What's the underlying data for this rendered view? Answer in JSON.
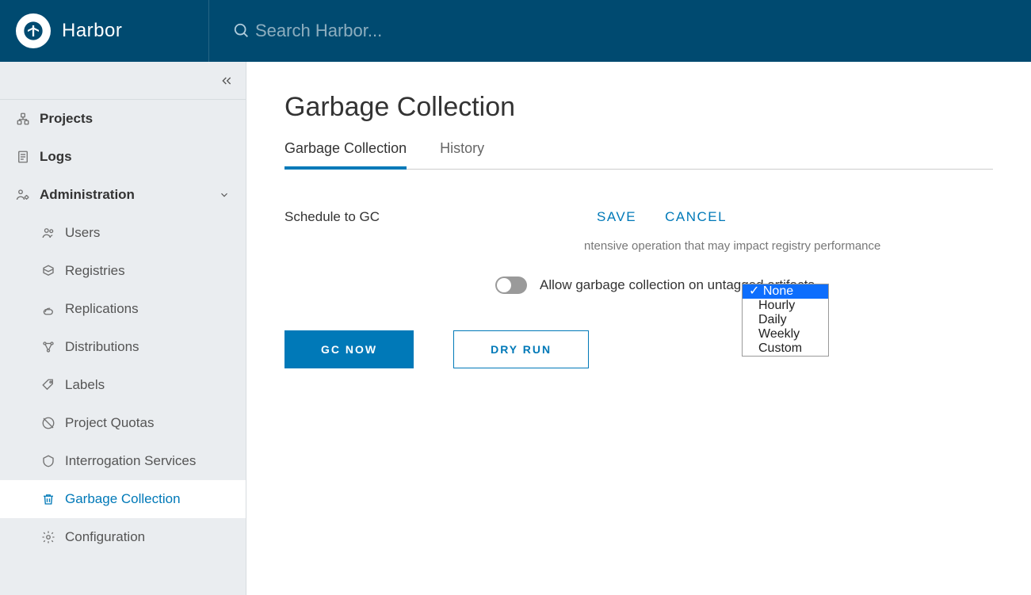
{
  "header": {
    "product": "Harbor",
    "search_placeholder": "Search Harbor..."
  },
  "sidebar": {
    "top": [
      {
        "label": "Projects"
      },
      {
        "label": "Logs"
      }
    ],
    "admin_label": "Administration",
    "admin_items": [
      {
        "label": "Users"
      },
      {
        "label": "Registries"
      },
      {
        "label": "Replications"
      },
      {
        "label": "Distributions"
      },
      {
        "label": "Labels"
      },
      {
        "label": "Project Quotas"
      },
      {
        "label": "Interrogation Services"
      },
      {
        "label": "Garbage Collection"
      },
      {
        "label": "Configuration"
      }
    ]
  },
  "page": {
    "title": "Garbage Collection",
    "tabs": [
      {
        "label": "Garbage Collection"
      },
      {
        "label": "History"
      }
    ],
    "schedule_label": "Schedule to GC",
    "save": "SAVE",
    "cancel": "CANCEL",
    "info_fragment": "ntensive operation that may impact registry performance",
    "toggle_label": "Allow garbage collection on untagged artifacts",
    "gc_now": "GC NOW",
    "dry_run": "DRY RUN"
  },
  "dropdown": {
    "selected": "None",
    "options": [
      "None",
      "Hourly",
      "Daily",
      "Weekly",
      "Custom"
    ]
  }
}
